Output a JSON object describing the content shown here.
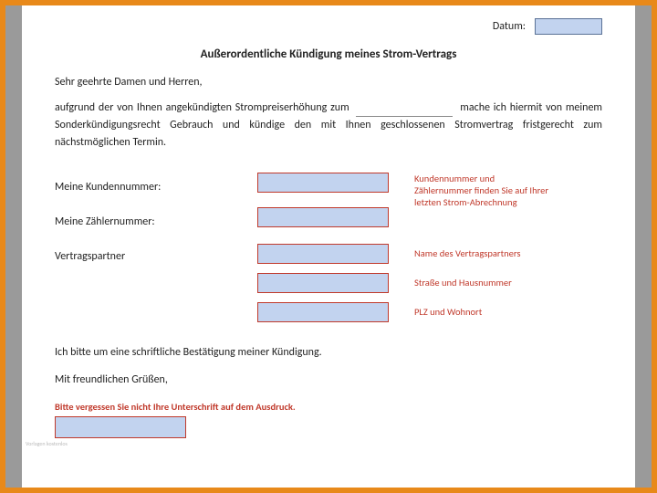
{
  "date": {
    "label": "Datum:"
  },
  "title": "Außerordentliche Kündigung meines Strom-Vertrags",
  "salutation": "Sehr geehrte Damen und Herren,",
  "body_pre": "aufgrund der von Ihnen angekündigten Strompreiserhöhung zum ",
  "body_post": " mache ich hiermit von meinem Sonderkündigungsrecht Gebrauch und kündige den mit Ihnen geschlossenen Stromvertrag fristgerecht zum nächstmöglichen Termin.",
  "labels": {
    "kundennummer": "Meine Kundennummer:",
    "zaehlernummer": "Meine Zählernummer:",
    "vertragspartner": "Vertragspartner"
  },
  "hints": {
    "kz": "Kundennummer und Zählernummer finden Sie auf Ihrer letzten Strom-Abrechnung",
    "name": "Name des Vertragspartners",
    "strasse": "Straße und Hausnummer",
    "plz": "PLZ und Wohnort"
  },
  "confirm": "Ich bitte um eine schriftliche Bestätigung meiner Kündigung.",
  "closing": "Mit freundlichen Grüßen,",
  "sig_hint": "Bitte vergessen Sie nicht Ihre Unterschrift auf dem Ausdruck.",
  "watermark": "Vorlagen kostenlos"
}
